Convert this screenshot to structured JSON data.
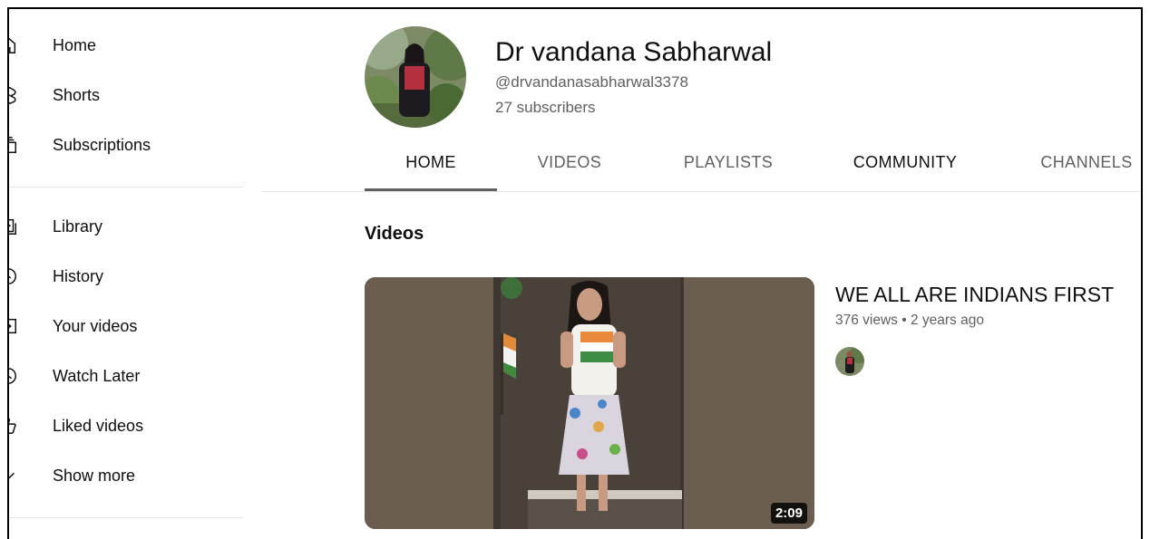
{
  "sidebar": {
    "items": [
      {
        "label": "Home",
        "icon": "home-icon"
      },
      {
        "label": "Shorts",
        "icon": "shorts-icon"
      },
      {
        "label": "Subscriptions",
        "icon": "subscriptions-icon"
      },
      {
        "label": "Library",
        "icon": "library-icon"
      },
      {
        "label": "History",
        "icon": "history-icon"
      },
      {
        "label": "Your videos",
        "icon": "your-videos-icon"
      },
      {
        "label": "Watch Later",
        "icon": "watch-later-icon"
      },
      {
        "label": "Liked videos",
        "icon": "liked-videos-icon"
      },
      {
        "label": "Show more",
        "icon": "chevron-down-icon"
      }
    ]
  },
  "channel": {
    "name": "Dr vandana Sabharwal",
    "handle": "@drvandanasabharwal3378",
    "subscribers": "27 subscribers",
    "avatar_icon": "channel-avatar"
  },
  "tabs": [
    {
      "label": "HOME",
      "active": true
    },
    {
      "label": "VIDEOS",
      "active": false
    },
    {
      "label": "PLAYLISTS",
      "active": false
    },
    {
      "label": "COMMUNITY",
      "active": false
    },
    {
      "label": "CHANNELS",
      "active": false
    }
  ],
  "section": {
    "title": "Videos"
  },
  "featured_video": {
    "title": "WE ALL ARE INDIANS FIRST",
    "meta": "376 views • 2 years ago",
    "duration": "2:09"
  },
  "colors": {
    "text_primary": "#0f0f0f",
    "text_secondary": "#606060",
    "divider": "#e5e5e5"
  }
}
